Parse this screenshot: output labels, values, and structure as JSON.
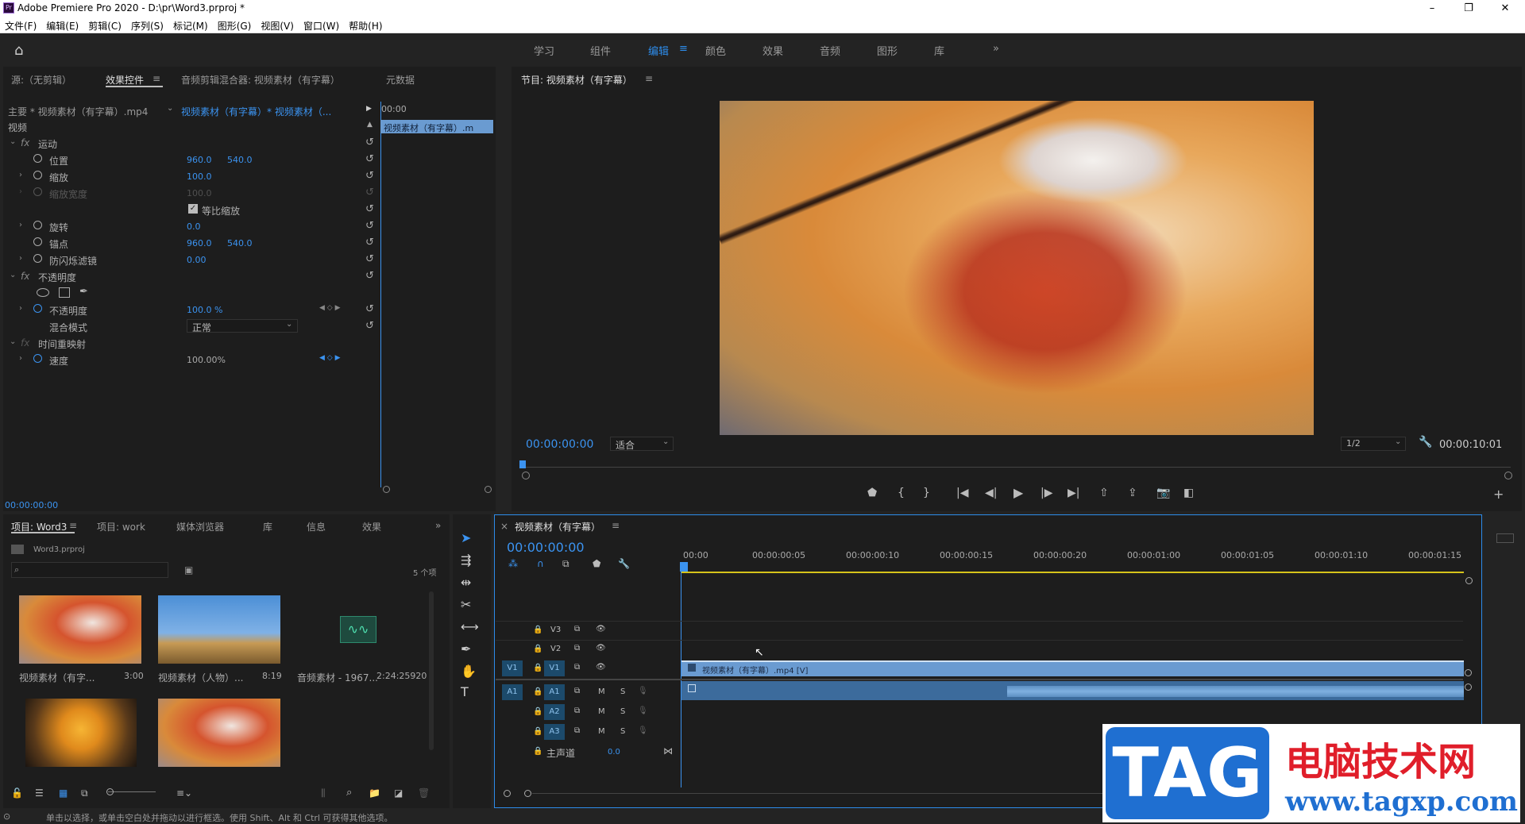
{
  "app": {
    "title": "Adobe Premiere Pro 2020 - D:\\pr\\Word3.prproj *",
    "min": "–",
    "max": "❐",
    "close": "✕"
  },
  "menu": [
    "文件(F)",
    "编辑(E)",
    "剪辑(C)",
    "序列(S)",
    "标记(M)",
    "图形(G)",
    "视图(V)",
    "窗口(W)",
    "帮助(H)"
  ],
  "workspaces": [
    "学习",
    "组件",
    "编辑",
    "颜色",
    "效果",
    "音频",
    "图形",
    "库"
  ],
  "workspace_more": "»",
  "source_tabs": {
    "source": "源:（无剪辑）",
    "effects": "效果控件",
    "mixer": "音频剪辑混合器: 视频素材（有字幕）",
    "meta": "元数据"
  },
  "ec": {
    "master": "主要 * 视频素材（有字幕）.mp4",
    "seq": "视频素材（有字幕）* 视频素材（...",
    "time0": "00:00",
    "clipbar": "视频素材（有字幕）.m",
    "section": "视频",
    "motion": "运动",
    "position": "位置",
    "pos_x": "960.0",
    "pos_y": "540.0",
    "scale": "缩放",
    "scale_v": "100.0",
    "scalew": "缩放宽度",
    "scalew_v": "100.0",
    "uniform": "等比缩放",
    "rotate": "旋转",
    "rotate_v": "0.0",
    "anchor": "锚点",
    "anc_x": "960.0",
    "anc_y": "540.0",
    "flicker": "防闪烁滤镜",
    "flicker_v": "0.00",
    "opacity": "不透明度",
    "opacity2": "不透明度",
    "opacity_v": "100.0 %",
    "blend": "混合模式",
    "blend_v": "正常",
    "timeremap": "时间重映射",
    "speed": "速度",
    "speed_v": "100.00%",
    "tc": "00:00:00:00"
  },
  "program": {
    "title": "节目: 视频素材（有字幕）",
    "tc": "00:00:00:00",
    "fit": "适合",
    "res": "1/2",
    "dur": "00:00:10:01"
  },
  "project": {
    "tabs": [
      "项目: Word3",
      "项目: work",
      "媒体浏览器",
      "库",
      "信息",
      "效果"
    ],
    "file": "Word3.prproj",
    "count": "5 个项",
    "items": [
      {
        "name": "视频素材（有字...",
        "dur": "3:00"
      },
      {
        "name": "视频素材（人物）...",
        "dur": "8:19"
      },
      {
        "name": "音频素材 - 1967...",
        "dur": "2:24:25920"
      }
    ]
  },
  "timeline": {
    "title": "视频素材（有字幕）",
    "tc": "00:00:00:00",
    "ruler": [
      "00:00",
      "00:00:00:05",
      "00:00:00:10",
      "00:00:00:15",
      "00:00:00:20",
      "00:00:01:00",
      "00:00:01:05",
      "00:00:01:10",
      "00:00:01:15"
    ],
    "clip": "视频素材（有字幕）.mp4 [V]",
    "master": "主声道",
    "master_v": "0.0",
    "tracks_v": [
      "V3",
      "V2",
      "V1"
    ],
    "tracks_a": [
      "A1",
      "A2",
      "A3"
    ],
    "src_v": "V1",
    "src_a": "A1",
    "M": "M",
    "S": "S"
  },
  "status": "单击以选择，或单击空白处并拖动以进行框选。使用 Shift、Alt 和 Ctrl 可获得其他选项。",
  "watermark": {
    "tag": "TAG",
    "site": "电脑技术网",
    "url": "www.tagxp.com"
  },
  "colors": {
    "accent": "#2d8ceb",
    "track_blue": "#1c4a6b",
    "clip": "#6a9bd1"
  }
}
